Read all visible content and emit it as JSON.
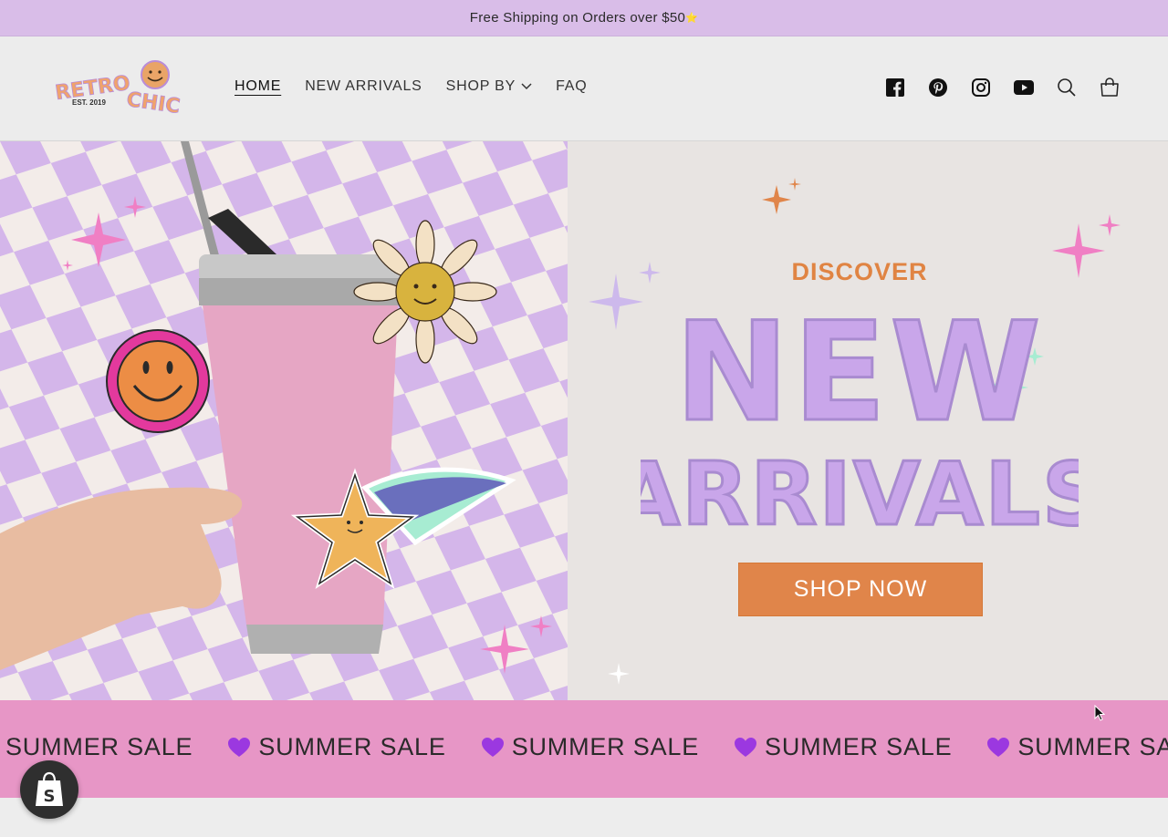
{
  "announcement": {
    "text": "Free Shipping on Orders over $50",
    "emoji": "⭐"
  },
  "logo": {
    "line1": "RETROCHIC",
    "est": "EST. 2019"
  },
  "nav": {
    "items": [
      {
        "label": "HOME"
      },
      {
        "label": "NEW ARRIVALS"
      },
      {
        "label": "SHOP BY"
      },
      {
        "label": "FAQ"
      }
    ]
  },
  "header_icons": [
    "facebook-icon",
    "pinterest-icon",
    "instagram-icon",
    "youtube-icon",
    "search-icon",
    "cart-icon"
  ],
  "hero": {
    "eyebrow": "DISCOVER",
    "title_line1": "NEW",
    "title_line2": "ARRIVALS",
    "cta": "SHOP NOW"
  },
  "marquee": {
    "items": [
      "SUMMER SALE",
      "SUMMER SALE",
      "SUMMER SALE",
      "SUMMER SALE",
      "SUMMER SALE"
    ]
  },
  "colors": {
    "announcement_bg": "#d9bde8",
    "accent_orange": "#e0854a",
    "lavender": "#c9a6ea",
    "marquee_pink": "#e796c6"
  }
}
